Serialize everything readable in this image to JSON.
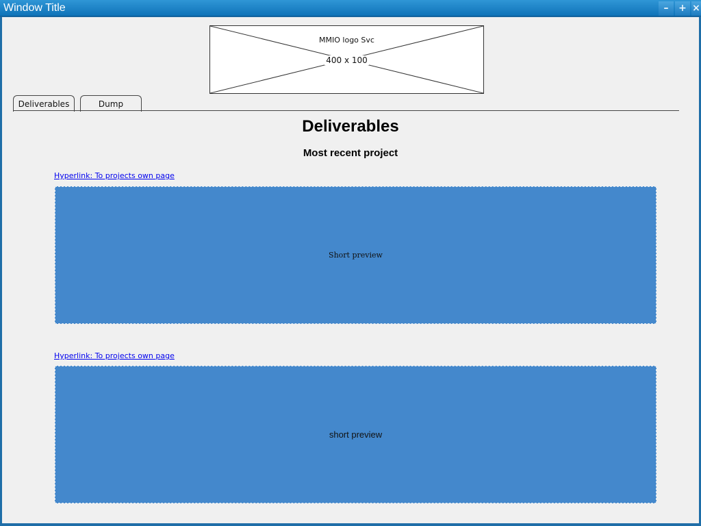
{
  "window": {
    "title": "Window Title",
    "controls": {
      "minimize_icon": "minimize-icon",
      "maximize_icon": "maximize-icon",
      "close_icon": "close-icon",
      "minimize_glyph": "–",
      "maximize_glyph": "+",
      "close_glyph": "×"
    }
  },
  "logo": {
    "label": "MMIO logo Svc",
    "size_text": "400 x 100"
  },
  "tabs": [
    {
      "label": "Deliverables"
    },
    {
      "label": "Dump"
    }
  ],
  "content": {
    "heading": "Deliverables",
    "subheading": "Most recent project",
    "projects": [
      {
        "link_text": "Hyperlink: To projects own page",
        "preview_text": "Short preview"
      },
      {
        "link_text": "Hyperlink: To projects own page",
        "preview_text": "short preview"
      }
    ]
  },
  "colors": {
    "titlebar": "#1a82c8",
    "preview_fill": "#4488cc",
    "link": "#0000ee",
    "background": "#f0f0f0"
  }
}
